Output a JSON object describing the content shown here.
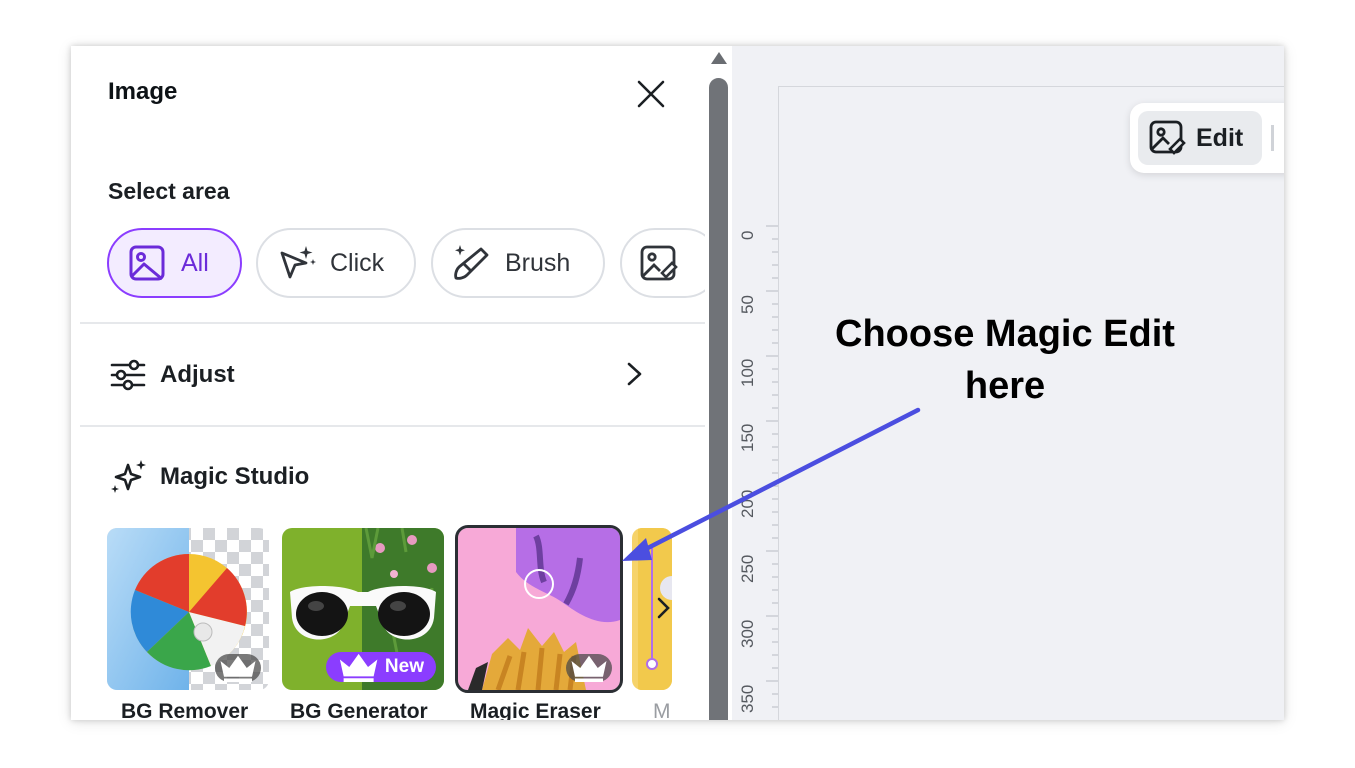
{
  "panel": {
    "title": "Image",
    "select_area": {
      "label": "Select area",
      "options": [
        {
          "label": "All",
          "icon": "image-icon",
          "active": true
        },
        {
          "label": "Click",
          "icon": "magic-click-icon",
          "active": false
        },
        {
          "label": "Brush",
          "icon": "magic-brush-icon",
          "active": false
        },
        {
          "label": "",
          "icon": "image-edit-icon",
          "active": false
        }
      ]
    },
    "adjust": {
      "label": "Adjust",
      "icon": "sliders-icon"
    },
    "magic_studio": {
      "label": "Magic Studio",
      "icon": "sparkles-icon",
      "tools": [
        {
          "label": "BG Remover",
          "badge": "crown"
        },
        {
          "label": "BG Generator",
          "badge": "New"
        },
        {
          "label": "Magic Eraser",
          "badge": "crown"
        },
        {
          "label": "M",
          "badge": ""
        }
      ]
    }
  },
  "canvas": {
    "toolbar": {
      "edit_label": "Edit"
    },
    "ruler": [
      "0",
      "50",
      "100",
      "150",
      "200",
      "250",
      "300",
      "350"
    ]
  },
  "annotation": {
    "line1": "Choose Magic Edit",
    "line2": "here"
  },
  "colors": {
    "accent": "#8b3dff",
    "arrow": "#4b4ee0"
  }
}
